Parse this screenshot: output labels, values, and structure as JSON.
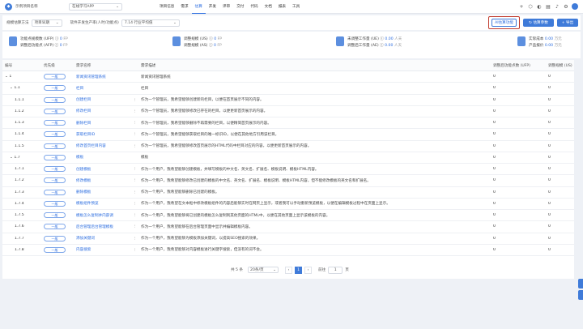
{
  "topbar": {
    "project_name": "示例项目名称",
    "project_select": "在线学习APP",
    "nav": [
      "项目信息",
      "需求",
      "估算",
      "开发",
      "评审",
      "交付",
      "代码",
      "文档",
      "报表",
      "工具"
    ],
    "active_nav": "估算"
  },
  "toolbar": {
    "label1": "规模估算方法",
    "select1": "项目早期",
    "label2": "软件开发生产率(人时/功能点)",
    "select2": "7.14  行业平均值",
    "ai_button": "AI估算功能",
    "btn_refresh": "↻ 估算参数",
    "btn_export": "+ 导出"
  },
  "stats": [
    {
      "l1": "功能点规模数 (UFP)",
      "v1": "0",
      "u1": "FP",
      "l2": "调整后功能点 (AFP)",
      "v2": "0",
      "u2": "FP"
    },
    {
      "l1": "调整规模 (US)",
      "v1": "0",
      "u1": "FP",
      "l2": "调整规模 (AS)",
      "v2": "0",
      "u2": "FP"
    },
    {
      "l1": "未调整工作量 (UE)",
      "v1": "0.00",
      "u1": "人天",
      "l2": "调整后工作量 (AE)",
      "v2": "0.00",
      "u2": "人天"
    },
    {
      "l1": "实际成本",
      "v1": "0.00",
      "u1": "万元",
      "l2": "产品报价",
      "v2": "0.00",
      "u2": "万元"
    }
  ],
  "table": {
    "headers": [
      "编号",
      "优先级",
      "需求名称",
      "需求描述",
      "调整后功能点数 (UFP)",
      "调整规模 (US)"
    ],
    "rows": [
      {
        "id": "1",
        "priority": "一般",
        "name": "新闻资讯管理系统",
        "desc": "新闻资讯管理系统",
        "fp": "0",
        "ds": "0",
        "indent": 0,
        "exp": true
      },
      {
        "id": "1.1",
        "priority": "一般",
        "name": "栏目",
        "desc": "栏目",
        "fp": "0",
        "ds": "0",
        "indent": 1,
        "exp": true
      },
      {
        "id": "1.1.1",
        "priority": "一般",
        "name": "创建栏目",
        "desc": "作为一个管理员，我希望能够创建新的栏目，以便在首页展示不同的内容。",
        "fp": "0",
        "ds": "0",
        "indent": 2
      },
      {
        "id": "1.1.2",
        "priority": "一般",
        "name": "修改栏目",
        "desc": "作为一个管理员，我希望能够修改已存在的栏目，以便更新首页展示的内容。",
        "fp": "0",
        "ds": "0",
        "indent": 2
      },
      {
        "id": "1.1.3",
        "priority": "一般",
        "name": "删除栏目",
        "desc": "作为一个管理员，我希望能够删除不再需要的栏目，以便精简首页展示的内容。",
        "fp": "0",
        "ds": "0",
        "indent": 2
      },
      {
        "id": "1.1.4",
        "priority": "一般",
        "name": "获取栏目ID",
        "desc": "作为一个管理员，我希望能够获取栏目的唯一标识ID，以便在其他地方引用该栏目。",
        "fp": "0",
        "ds": "0",
        "indent": 2
      },
      {
        "id": "1.1.5",
        "priority": "一般",
        "name": "修改首页栏目内容",
        "desc": "作为一个管理员，我希望能够修改首页展示的HTML代码中栏目对应的内容，以便更新首页展示的内容。",
        "fp": "0",
        "ds": "0",
        "indent": 2
      },
      {
        "id": "1.7",
        "priority": "一般",
        "name": "模板",
        "desc": "模板",
        "fp": "0",
        "ds": "0",
        "indent": 1,
        "exp": true
      },
      {
        "id": "1.7.1",
        "priority": "一般",
        "name": "创建模板",
        "desc": "作为一个用户，我希望能够创建模板，并填写模板的中文名、英文名、扩展名、模板说明、模板HTML内容。",
        "fp": "0",
        "ds": "0",
        "indent": 2
      },
      {
        "id": "1.7.2",
        "priority": "一般",
        "name": "修改模板",
        "desc": "作为一个用户，我希望能够修改已创建的模板的中文名、英文名、扩展名、模板说明、模板HTML内容，但不能修改模板的英文名和扩展名。",
        "fp": "0",
        "ds": "0",
        "indent": 2
      },
      {
        "id": "1.7.3",
        "priority": "一般",
        "name": "删除模板",
        "desc": "作为一个用户，我希望能够删除已创建的模板。",
        "fp": "0",
        "ds": "0",
        "indent": 2
      },
      {
        "id": "1.7.4",
        "priority": "一般",
        "name": "模板组件预览",
        "desc": "作为一个用户，我希望在文本框中修改模板组件的内容后能够实时在网页上显示，或者我可以手动重新预览模板，以便在编辑模板过程中在页面上显示。",
        "fp": "0",
        "ds": "0",
        "indent": 2
      },
      {
        "id": "1.7.5",
        "priority": "一般",
        "name": "模板怎么复制并内部调",
        "desc": "作为一个用户，我希望能够将已创建的模板怎么复制到其他页面的HTML中，以便在其他页面上显示该模板的内容。",
        "fp": "0",
        "ds": "0",
        "indent": 2
      },
      {
        "id": "1.7.6",
        "priority": "一般",
        "name": "后台管理后台管理模板",
        "desc": "作为一个用户，我希望能够在后台管理页面中显示并编辑模板内容。",
        "fp": "0",
        "ds": "0",
        "indent": 2
      },
      {
        "id": "1.7.7",
        "priority": "一般",
        "name": "添加关键词",
        "desc": "作为一个用户，我希望能够为模板添加关键词，以提高SEO搜索的效果。",
        "fp": "0",
        "ds": "0",
        "indent": 2
      },
      {
        "id": "1.7.8",
        "priority": "一般",
        "name": "内容搜索",
        "desc": "作为一个用户，我希望能够对内容模板进行关键字搜索，但没有的词不会。",
        "fp": "0",
        "ds": "0",
        "indent": 2
      }
    ]
  },
  "pager": {
    "total": "共 5 条",
    "page_size": "20条/页",
    "prev": "‹",
    "current": "1",
    "next": "›",
    "goto_label": "前往",
    "goto_value": "1",
    "page_unit": "页"
  }
}
